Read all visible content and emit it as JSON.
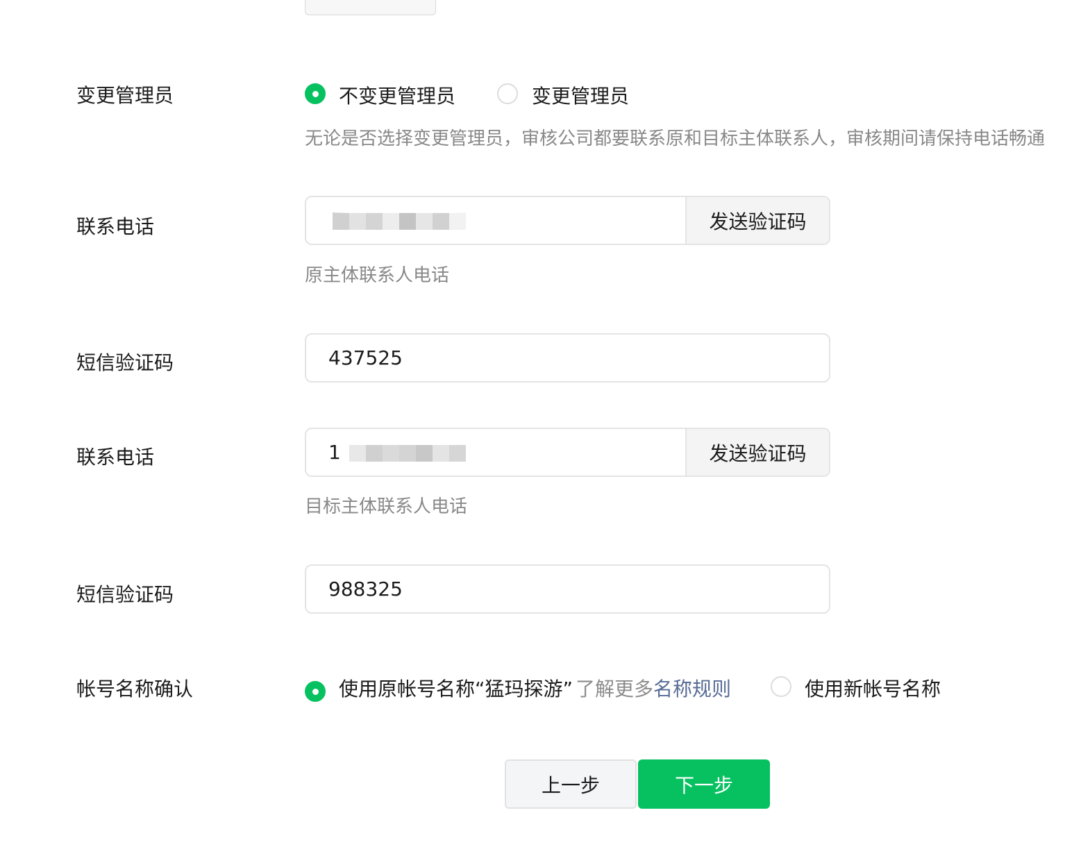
{
  "admin": {
    "label": "变更管理员",
    "options": [
      "不变更管理员",
      "变更管理员"
    ],
    "selected_index": 0,
    "hint": "无论是否选择变更管理员，审核公司都要联系原和目标主体联系人，审核期间请保持电话畅通"
  },
  "original_contact": {
    "phone_label": "联系电话",
    "phone_value": "",
    "send_code_label": "发送验证码",
    "phone_hint": "原主体联系人电话",
    "sms_label": "短信验证码",
    "sms_value": "437525"
  },
  "target_contact": {
    "phone_label": "联系电话",
    "phone_value_visible_prefix": "1",
    "send_code_label": "发送验证码",
    "phone_hint": "目标主体联系人电话",
    "sms_label": "短信验证码",
    "sms_value": "988325"
  },
  "account_name": {
    "label": "帐号名称确认",
    "option_original": "使用原帐号名称“猛玛探游”",
    "learn_more": "了解更多",
    "rules_link": "名称规则",
    "option_new": "使用新帐号名称",
    "selected_index": 0
  },
  "buttons": {
    "prev": "上一步",
    "next": "下一步"
  },
  "colors": {
    "primary": "#07c160",
    "link": "#576b95",
    "hint": "#888888"
  }
}
